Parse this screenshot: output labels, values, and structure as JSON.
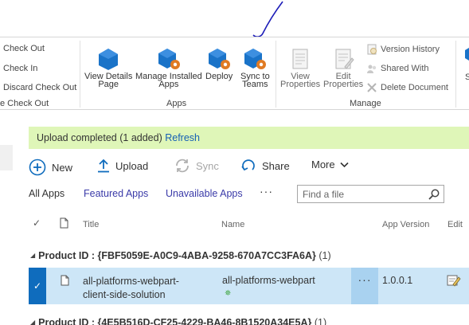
{
  "ribbon": {
    "files_group": {
      "check_out": "Check Out",
      "check_in": "Check In",
      "discard_check_out": "Discard Check Out",
      "override_check_out": "e Check Out"
    },
    "apps_group": {
      "label": "Apps",
      "view_details_line1": "View Details",
      "view_details_line2": "Page",
      "manage_installed_line1": "Manage Installed",
      "manage_installed_line2": "Apps",
      "deploy": "Deploy",
      "sync_teams_line1": "Sync to",
      "sync_teams_line2": "Teams"
    },
    "manage_group": {
      "label": "Manage",
      "view_properties_line1": "View",
      "view_properties_line2": "Properties",
      "edit_properties_line1": "Edit",
      "edit_properties_line2": "Properties",
      "version_history": "Version History",
      "shared_with": "Shared With",
      "delete_document": "Delete Document"
    },
    "trailing_fragment": "S"
  },
  "status": {
    "message": "Upload completed (1 added)",
    "refresh_link": "Refresh",
    "color": "#dff6b8"
  },
  "commands": {
    "new": "New",
    "upload": "Upload",
    "sync": "Sync",
    "share": "Share",
    "more": "More"
  },
  "views": {
    "all_apps": "All Apps",
    "featured_apps": "Featured Apps",
    "unavailable_apps": "Unavailable Apps",
    "more": "···"
  },
  "search": {
    "placeholder": "Find a file"
  },
  "columns": {
    "title": "Title",
    "name": "Name",
    "app_version": "App Version",
    "edit": "Edit"
  },
  "groups": [
    {
      "prefix": "Product ID : ",
      "id": "{FBF5059E-A0C9-4ABA-9258-670A7CC3FA6A}",
      "count": "(1)"
    },
    {
      "prefix": "Product ID : ",
      "id": "{4E5B516D-CF25-4229-BA46-8B1520A34E5A}",
      "count": "(1)"
    }
  ],
  "rows": [
    {
      "title_line1": "all-platforms-webpart-",
      "title_line2": "client-side-solution",
      "name": "all-platforms-webpart",
      "new_marker": "✵",
      "version": "1.0.0.1",
      "more": "···"
    }
  ],
  "colors": {
    "accent": "#0f6cbd",
    "selection": "#cde6f7",
    "link": "#1560b4",
    "icon_blue": "#1a73c8",
    "gear_orange": "#e07b24"
  }
}
